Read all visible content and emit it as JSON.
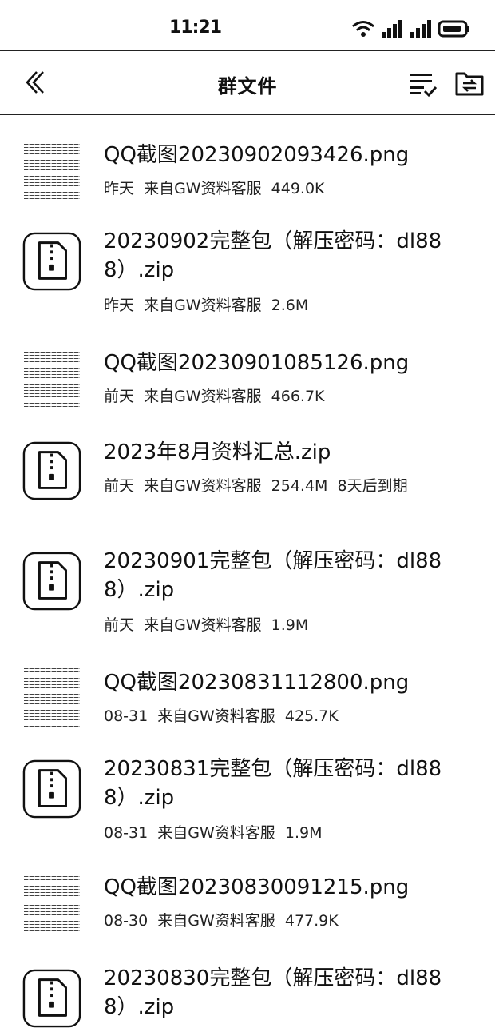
{
  "status_bar": {
    "time": "11:21"
  },
  "header": {
    "title": "群文件"
  },
  "files": [
    {
      "name": "QQ截图20230902093426.png",
      "meta": "昨天  来自GW资料客服  449.0K",
      "type": "image"
    },
    {
      "name": "20230902完整包（解压密码：dl888）.zip",
      "meta": "昨天  来自GW资料客服  2.6M",
      "type": "zip"
    },
    {
      "name": "QQ截图20230901085126.png",
      "meta": "前天  来自GW资料客服  466.7K",
      "type": "image"
    },
    {
      "name": "2023年8月资料汇总.zip",
      "meta": "前天  来自GW资料客服  254.4M  8天后到期",
      "type": "zip"
    },
    {
      "name": "20230901完整包（解压密码：dl888）.zip",
      "meta": "前天  来自GW资料客服  1.9M",
      "type": "zip"
    },
    {
      "name": "QQ截图20230831112800.png",
      "meta": "08-31  来自GW资料客服  425.7K",
      "type": "image"
    },
    {
      "name": "20230831完整包（解压密码：dl888）.zip",
      "meta": "08-31  来自GW资料客服  1.9M",
      "type": "zip"
    },
    {
      "name": "QQ截图20230830091215.png",
      "meta": "08-30  来自GW资料客服  477.9K",
      "type": "image"
    },
    {
      "name": "20230830完整包（解压密码：dl888）.zip",
      "meta": "",
      "type": "zip"
    }
  ]
}
